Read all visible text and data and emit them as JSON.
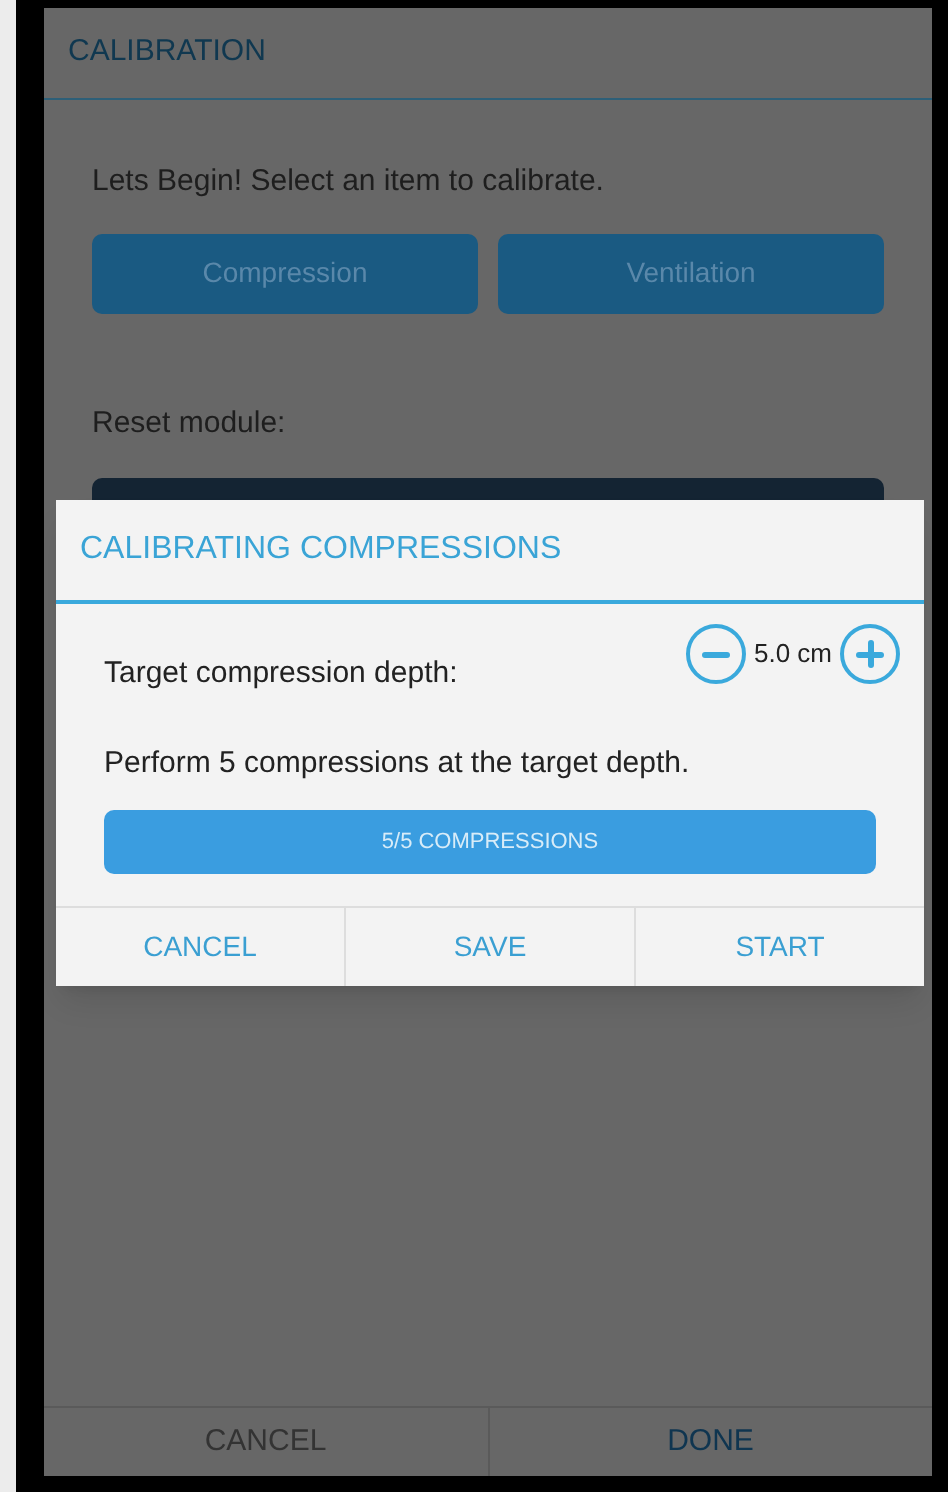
{
  "screen": {
    "title": "CALIBRATION",
    "prompt": "Lets Begin! Select an item to calibrate.",
    "calibration_items": [
      "Compression",
      "Ventilation"
    ],
    "reset_label": "Reset module:",
    "footer_buttons": [
      "CANCEL",
      "DONE"
    ]
  },
  "dialog": {
    "title": "CALIBRATING COMPRESSIONS",
    "depth_label": "Target compression depth:",
    "depth_value": "5.0 cm",
    "instruction": "Perform 5 compressions at the target depth.",
    "progress": {
      "level": 1,
      "label": "5/5 COMPRESSIONS"
    },
    "buttons": [
      "CANCEL",
      "SAVE",
      "START"
    ]
  }
}
